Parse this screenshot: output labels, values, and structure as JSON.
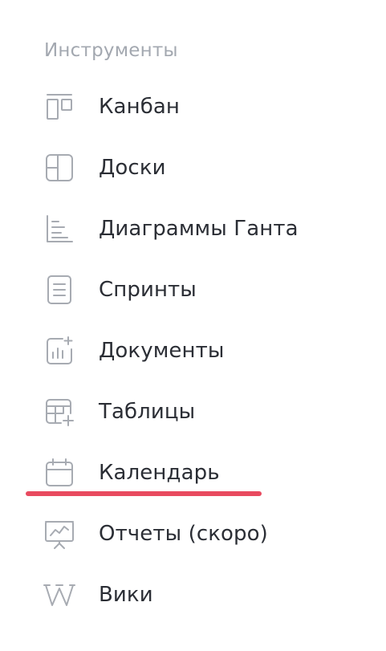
{
  "section": {
    "title": "Инструменты"
  },
  "items": [
    {
      "label": "Канбан",
      "icon": "kanban-icon"
    },
    {
      "label": "Доски",
      "icon": "boards-icon"
    },
    {
      "label": "Диаграммы Ганта",
      "icon": "gantt-icon"
    },
    {
      "label": "Спринты",
      "icon": "sprints-icon"
    },
    {
      "label": "Документы",
      "icon": "documents-icon"
    },
    {
      "label": "Таблицы",
      "icon": "tables-icon"
    },
    {
      "label": "Календарь",
      "icon": "calendar-icon"
    },
    {
      "label": "Отчеты (скоро)",
      "icon": "reports-icon"
    },
    {
      "label": "Вики",
      "icon": "wiki-icon"
    }
  ],
  "colors": {
    "icon_stroke": "#a7abb2",
    "label_text": "#2b2e35",
    "section_title": "#a3a8b0",
    "highlight_underline": "#e84a5f"
  }
}
